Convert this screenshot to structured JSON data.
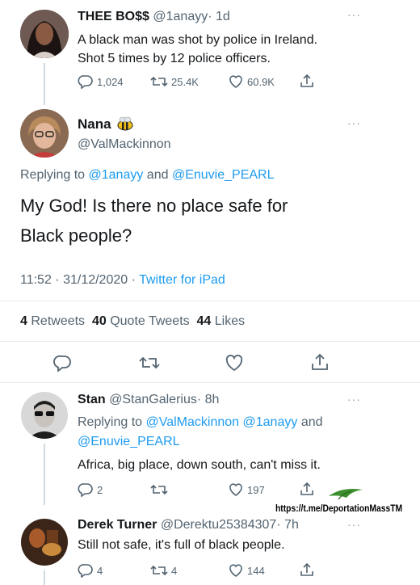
{
  "tweet1": {
    "name": "THEE BO$$",
    "handle": "@1anayy",
    "time": "· 1d",
    "line1": "A black man was shot by police in Ireland.",
    "line2": "Shot 5 times by 12 police officers.",
    "replies": "1,024",
    "retweets": "25.4K",
    "likes": "60.9K"
  },
  "main": {
    "name": "Nana",
    "handle": "@ValMackinnon",
    "replying_prefix": "Replying to",
    "replying_user1": "@1anayy",
    "replying_and": "and",
    "replying_user2": "@Enuvie_PEARL",
    "text_line1": "My God!  Is there no place safe for",
    "text_line2": "Black people?",
    "timestamp": "11:52 · 31/12/2020 ·",
    "source": "Twitter for iPad",
    "stat_retweets_num": "4",
    "stat_retweets_label": "Retweets",
    "stat_quotes_num": "40",
    "stat_quotes_label": "Quote Tweets",
    "stat_likes_num": "44",
    "stat_likes_label": "Likes"
  },
  "reply1": {
    "name": "Stan",
    "handle": "@StanGalerius",
    "time": "· 8h",
    "replying_prefix": "Replying to",
    "replying_user1": "@ValMackinnon",
    "replying_user2": "@1anayy",
    "replying_and": "and",
    "replying_user3": "@Enuvie_PEARL",
    "text": "Africa, big place, down south, can't miss it.",
    "replies": "2",
    "likes": "197"
  },
  "watermark": {
    "text": "https://t.me/DeportationMassTM"
  },
  "reply2": {
    "name": "Derek Turner",
    "handle": "@Derektu25384307",
    "time": "· 7h",
    "text": "Still not safe, it's full of black people.",
    "replies": "4",
    "retweets": "4",
    "likes": "144"
  },
  "colors": {
    "link": "#1d9bf0",
    "muted": "#536471",
    "watermark_arrow": "#3d8f2e"
  }
}
